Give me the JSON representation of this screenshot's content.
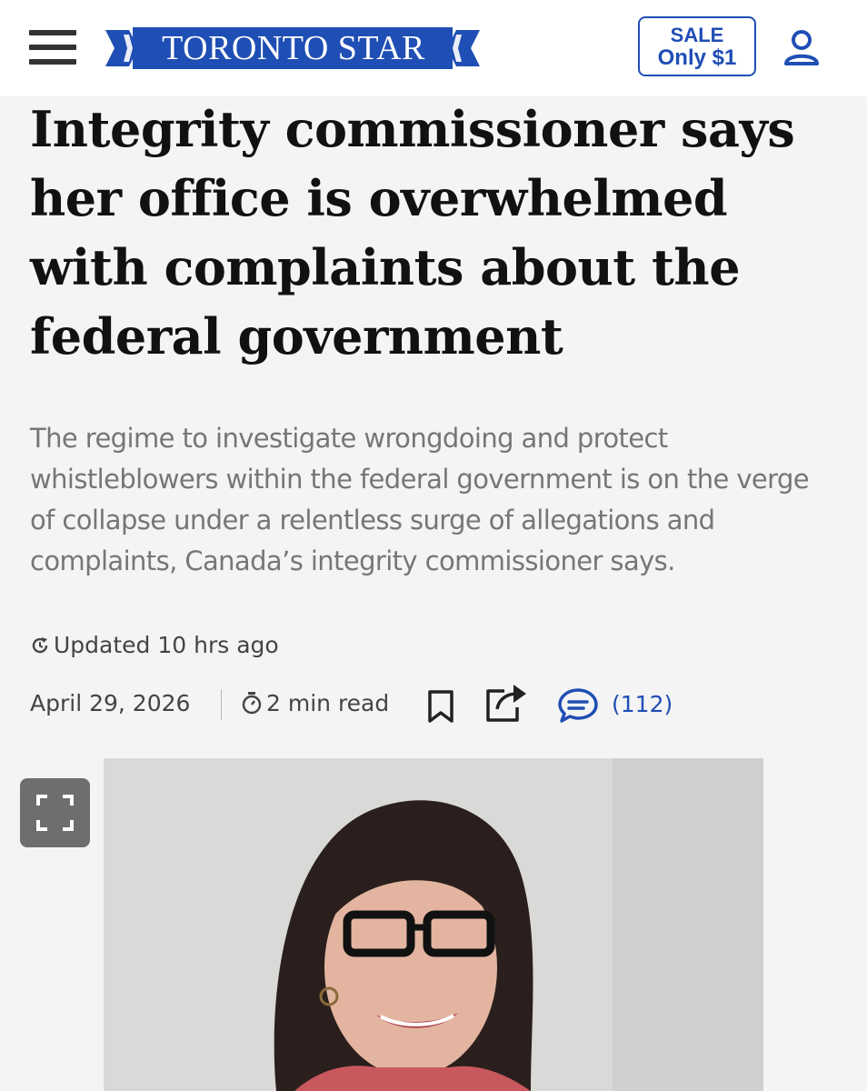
{
  "header": {
    "brand": "TORONTO STAR",
    "brand_color": "#1f4eb4",
    "sale_line1": "SALE",
    "sale_line2": "Only $1",
    "menu_icon": "hamburger-menu-icon",
    "account_icon": "user-account-icon"
  },
  "article": {
    "headline": "Integrity commissioner says her office is overwhelmed with complaints about the federal government",
    "summary": "The regime to investigate wrongdoing and protect whistleblowers within the federal government is on the verge of collapse under a relentless surge of allegations and complaints, Canada’s integrity commissioner says.",
    "updated": "Updated 10 hrs ago",
    "date": "April 29, 2026",
    "read_time": "2 min read",
    "comment_count": "(112)"
  },
  "media": {
    "image_alt": "photo of the integrity commissioner",
    "expand_icon": "fullscreen-expand-icon"
  }
}
